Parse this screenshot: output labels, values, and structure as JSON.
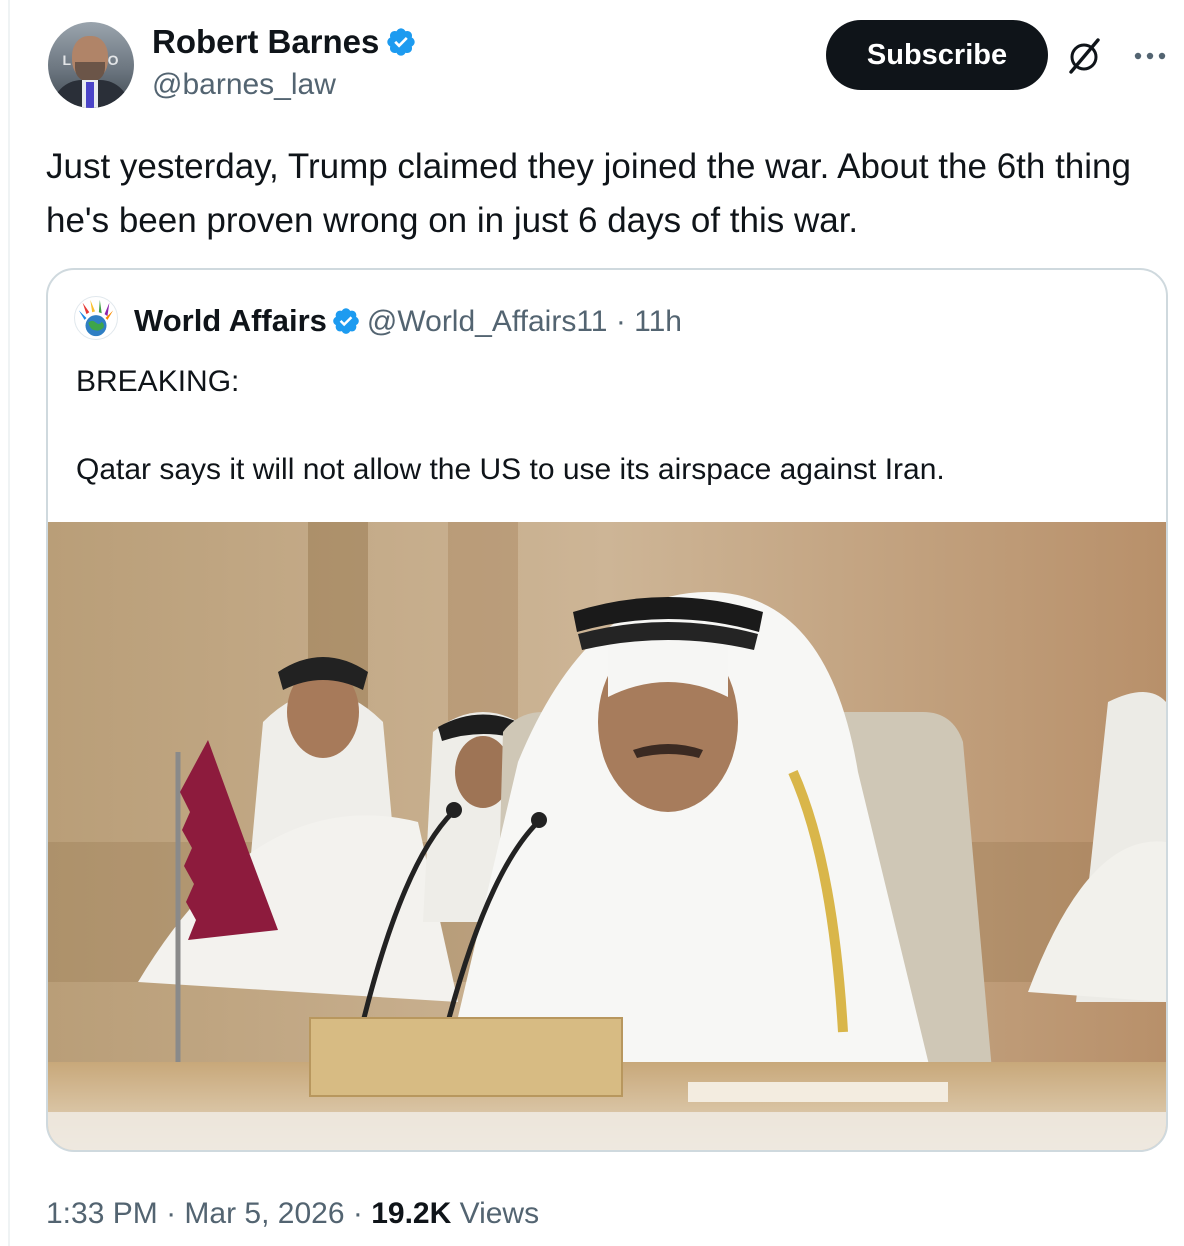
{
  "post": {
    "author": {
      "name": "Robert Barnes",
      "handle": "@barnes_law",
      "avatar_icon": "avatar-photo",
      "avatar_sign_text": "LAWNO"
    },
    "subscribe_label": "Subscribe",
    "text": "Just yesterday, Trump claimed they joined the war. About the 6th thing he's been proven wrong on in just 6 days of this war.",
    "quote": {
      "name": "World Affairs",
      "handle": "@World_Affairs11",
      "separator": "·",
      "time": "11h",
      "avatar_icon": "globe-hands-logo",
      "line1": "BREAKING:",
      "line2": "Qatar says it will not allow the US to use its airspace against Iran.",
      "image_icon": "summit-meeting-photo"
    },
    "footer": {
      "time": "1:33 PM",
      "sep1": "·",
      "date": "Mar 5, 2026",
      "sep2": "·",
      "views_count": "19.2K",
      "views_label": "Views"
    },
    "colors": {
      "verified_blue": "#1d9bf0",
      "text": "#0f1419",
      "secondary": "#536471",
      "border": "#cfd9de",
      "button_bg": "#0f1419"
    },
    "icons": [
      "verified-badge-icon",
      "grok-icon",
      "more-icon"
    ]
  }
}
